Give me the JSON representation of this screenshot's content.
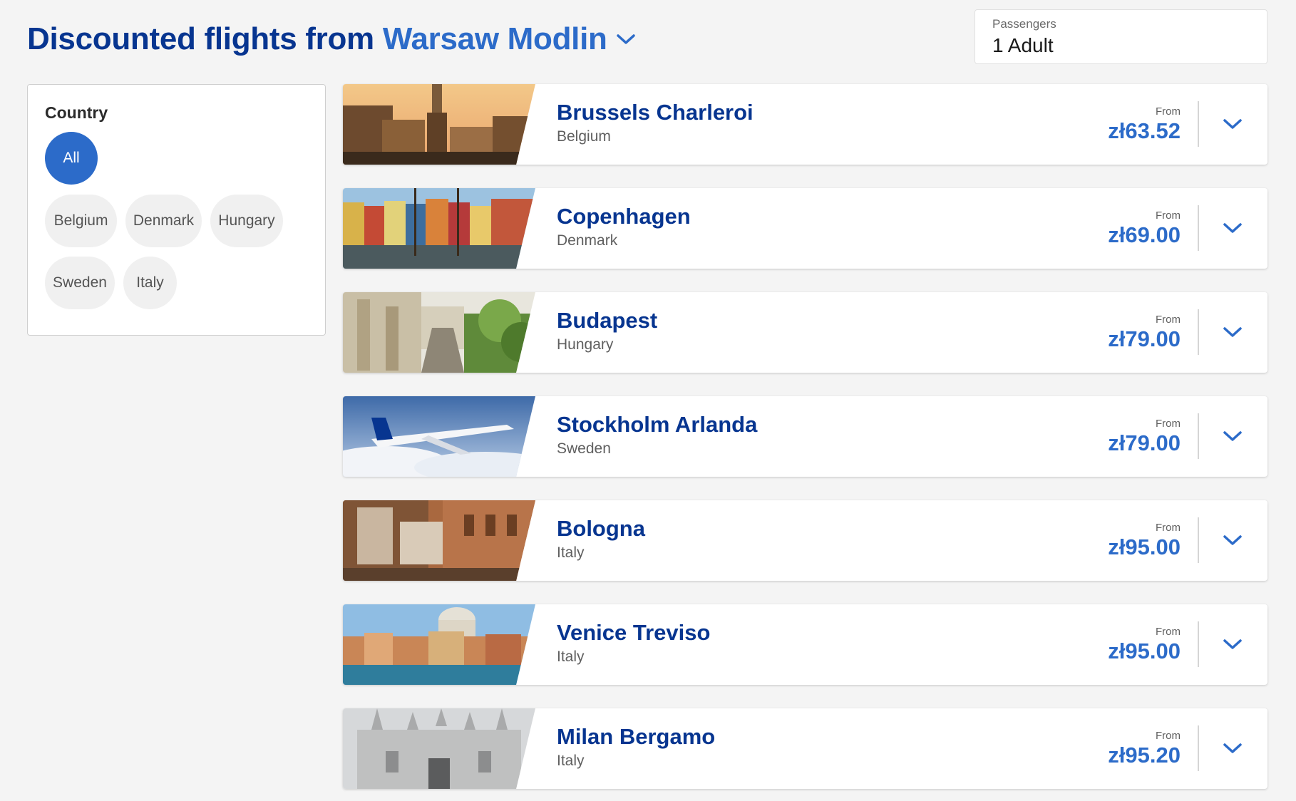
{
  "header": {
    "title_prefix": "Discounted flights from",
    "origin": "Warsaw Modlin"
  },
  "passengers": {
    "label": "Passengers",
    "value": "1 Adult"
  },
  "filter": {
    "title": "Country",
    "chips": [
      "All",
      "Belgium",
      "Denmark",
      "Hungary",
      "Sweden",
      "Italy"
    ],
    "selected": "All"
  },
  "destinations": [
    {
      "city": "Brussels Charleroi",
      "country": "Belgium",
      "from_label": "From",
      "price": "zł63.52",
      "image": "grand-place-photo"
    },
    {
      "city": "Copenhagen",
      "country": "Denmark",
      "from_label": "From",
      "price": "zł69.00",
      "image": "nyhavn-photo"
    },
    {
      "city": "Budapest",
      "country": "Hungary",
      "from_label": "From",
      "price": "zł79.00",
      "image": "fishermans-bastion-photo"
    },
    {
      "city": "Stockholm Arlanda",
      "country": "Sweden",
      "from_label": "From",
      "price": "zł79.00",
      "image": "ryanair-plane-photo"
    },
    {
      "city": "Bologna",
      "country": "Italy",
      "from_label": "From",
      "price": "zł95.00",
      "image": "bologna-towers-photo"
    },
    {
      "city": "Venice Treviso",
      "country": "Italy",
      "from_label": "From",
      "price": "zł95.00",
      "image": "grand-canal-photo"
    },
    {
      "city": "Milan Bergamo",
      "country": "Italy",
      "from_label": "From",
      "price": "zł95.20",
      "image": "milan-duomo-photo"
    }
  ],
  "colors": {
    "navy": "#073590",
    "blue": "#2c6bc9",
    "background": "#f4f4f4"
  }
}
